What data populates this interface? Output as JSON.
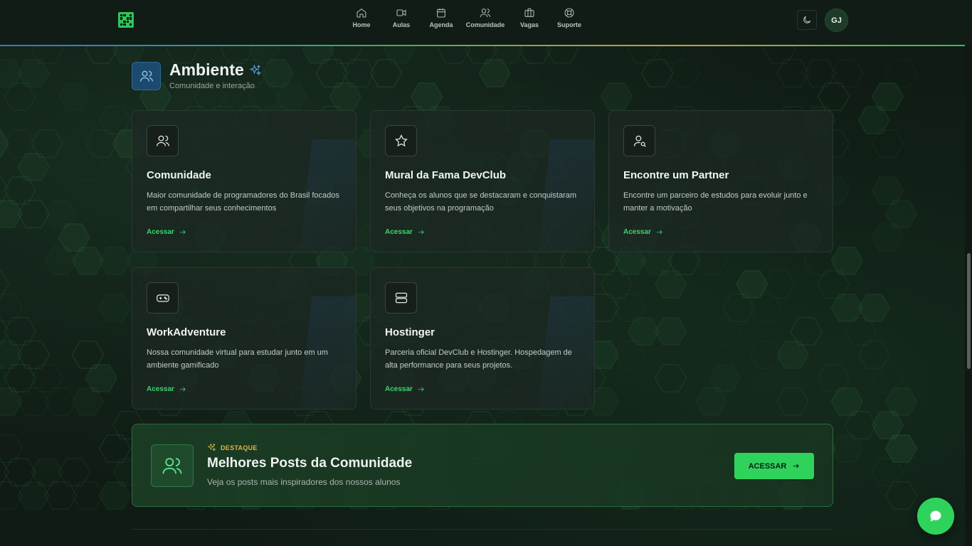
{
  "header": {
    "nav": [
      {
        "label": "Home",
        "icon": "home-icon"
      },
      {
        "label": "Aulas",
        "icon": "video-icon"
      },
      {
        "label": "Agenda",
        "icon": "calendar-icon"
      },
      {
        "label": "Comunidade",
        "icon": "users-icon"
      },
      {
        "label": "Vagas",
        "icon": "briefcase-icon"
      },
      {
        "label": "Suporte",
        "icon": "lifebuoy-icon"
      }
    ],
    "avatar_initials": "GJ"
  },
  "section": {
    "title": "Ambiente",
    "subtitle": "Comunidade e interação"
  },
  "cards": [
    {
      "title": "Comunidade",
      "description": "Maior comunidade de programadores do Brasil focados em compartilhar seus conhecimentos",
      "link": "Acessar",
      "icon": "users-icon"
    },
    {
      "title": "Mural da Fama DevClub",
      "description": "Conheça os alunos que se destacaram e conquistaram seus objetivos na programação",
      "link": "Acessar",
      "icon": "star-icon"
    },
    {
      "title": "Encontre um Partner",
      "description": "Encontre um parceiro de estudos para evoluir junto e manter a motivação",
      "link": "Acessar",
      "icon": "user-search-icon"
    },
    {
      "title": "WorkAdventure",
      "description": "Nossa comunidade virtual para estudar junto em um ambiente gamificado",
      "link": "Acessar",
      "icon": "gamepad-icon"
    },
    {
      "title": "Hostinger",
      "description": "Parceria oficial DevClub e Hostinger. Hospedagem de alta performance para seus projetos.",
      "link": "Acessar",
      "icon": "server-icon"
    }
  ],
  "featured": {
    "badge": "DESTAQUE",
    "title": "Melhores Posts da Comunidade",
    "subtitle": "Veja os posts mais inspiradores dos nossos alunos",
    "button": "ACESSAR"
  },
  "colors": {
    "accent": "#2fd35c",
    "badge": "#e2b442",
    "section_icon_bg": "#1c4a6e"
  }
}
